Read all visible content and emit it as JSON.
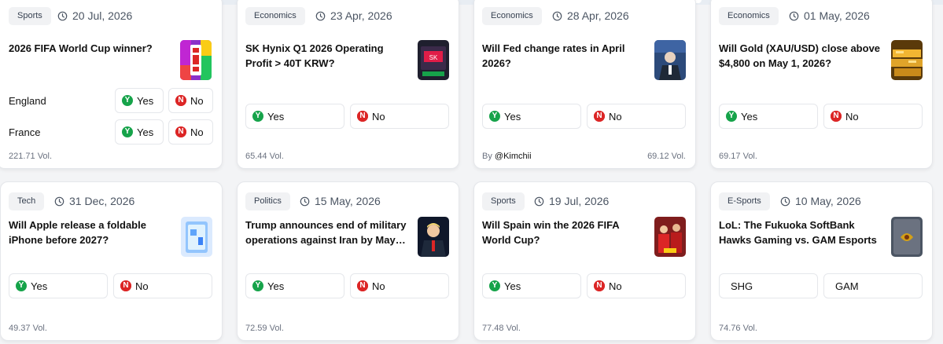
{
  "cards": [
    {
      "category": "Sports",
      "date": "20 Jul, 2026",
      "title": "2026 FIFA World Cup winner?",
      "rows": [
        {
          "label": "England",
          "yes": "Yes",
          "no": "No"
        },
        {
          "label": "France",
          "yes": "Yes",
          "no": "No"
        }
      ],
      "volume": "221.71 Vol."
    },
    {
      "category": "Economics",
      "date": "23 Apr, 2026",
      "title": "SK Hynix Q1 2026 Operating Profit > 40T KRW?",
      "yes": "Yes",
      "no": "No",
      "volume": "65.44 Vol."
    },
    {
      "category": "Economics",
      "date": "28 Apr, 2026",
      "title": "Will Fed change rates in April 2026?",
      "yes": "Yes",
      "no": "No",
      "by_prefix": "By",
      "by_user": "@Kimchii",
      "volume": "69.12 Vol."
    },
    {
      "category": "Economics",
      "date": "01 May, 2026",
      "title": "Will Gold (XAU/USD) close above $4,800 on May 1, 2026?",
      "yes": "Yes",
      "no": "No",
      "volume": "69.17 Vol."
    },
    {
      "category": "Tech",
      "date": "31 Dec, 2026",
      "title": "Will Apple release a foldable iPhone before 2027?",
      "yes": "Yes",
      "no": "No",
      "volume": "49.37 Vol."
    },
    {
      "category": "Politics",
      "date": "15 May, 2026",
      "title": "Trump announces end of military operations against Iran by May…",
      "yes": "Yes",
      "no": "No",
      "volume": "72.59 Vol."
    },
    {
      "category": "Sports",
      "date": "19 Jul, 2026",
      "title": "Will Spain win the 2026 FIFA World Cup?",
      "yes": "Yes",
      "no": "No",
      "volume": "77.48 Vol."
    },
    {
      "category": "E-Sports",
      "date": "10 May, 2026",
      "title": "LoL: The Fukuoka SoftBank Hawks Gaming vs. GAM Esports",
      "option_a": "SHG",
      "option_b": "GAM",
      "volume": "74.76 Vol."
    }
  ],
  "icons": {
    "yes_glyph": "Y",
    "no_glyph": "N",
    "clock": "clock-icon"
  },
  "colors": {
    "yes": "#16a34a",
    "no": "#dc2626",
    "page_bg": "#f3f4f6"
  }
}
